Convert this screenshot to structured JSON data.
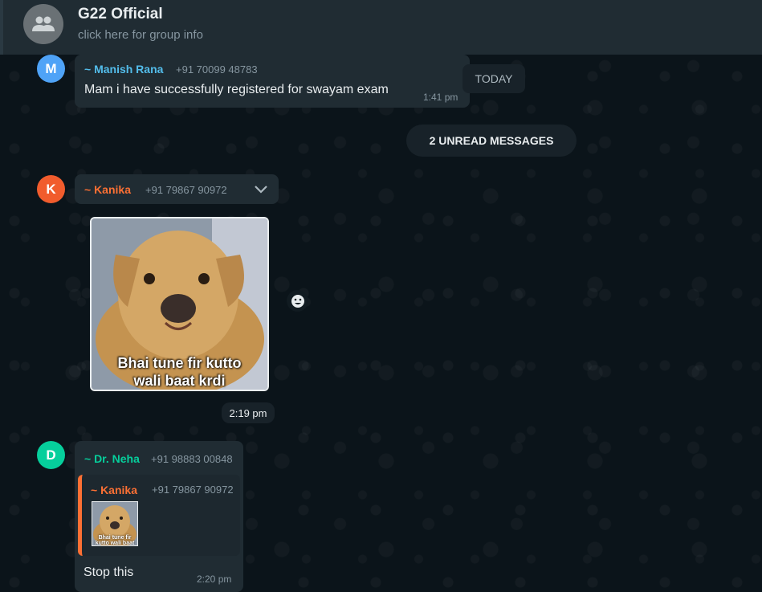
{
  "header": {
    "title": "G22 Official",
    "subtitle": "click here for group info",
    "avatar_icon": "group-icon"
  },
  "messages": [
    {
      "avatar_letter": "M",
      "avatar_color": "#4fa3f7",
      "sender": "~ Manish Rana",
      "phone": "+91 70099 48783",
      "text": "Mam i have successfully registered for swayam exam",
      "time": "1:41 pm"
    },
    {
      "avatar_letter": "K",
      "avatar_color": "#f15c2d",
      "sender": "~ Kanika",
      "phone": "+91 79867 90972",
      "sticker_caption_line1": "Bhai tune fir kutto",
      "sticker_caption_line2": "wali baat krdi",
      "time": "2:19 pm"
    },
    {
      "avatar_letter": "D",
      "avatar_color": "#06cf9c",
      "sender": "~ Dr. Neha",
      "phone": "+91 98883 00848",
      "quote_sender": "~ Kanika",
      "quote_phone": "+91 79867 90972",
      "quote_thumb_caption": "Bhai tune fir kutto wali baat krdi",
      "text": "Stop this",
      "time": "2:20 pm"
    }
  ],
  "date_pill": "TODAY",
  "unread_pill": "2 UNREAD MESSAGES",
  "colors": {
    "header_bg": "#202c33",
    "chat_bg": "#0b141a",
    "bubble_bg": "#202c33",
    "quote_accent": "#fc7034"
  }
}
